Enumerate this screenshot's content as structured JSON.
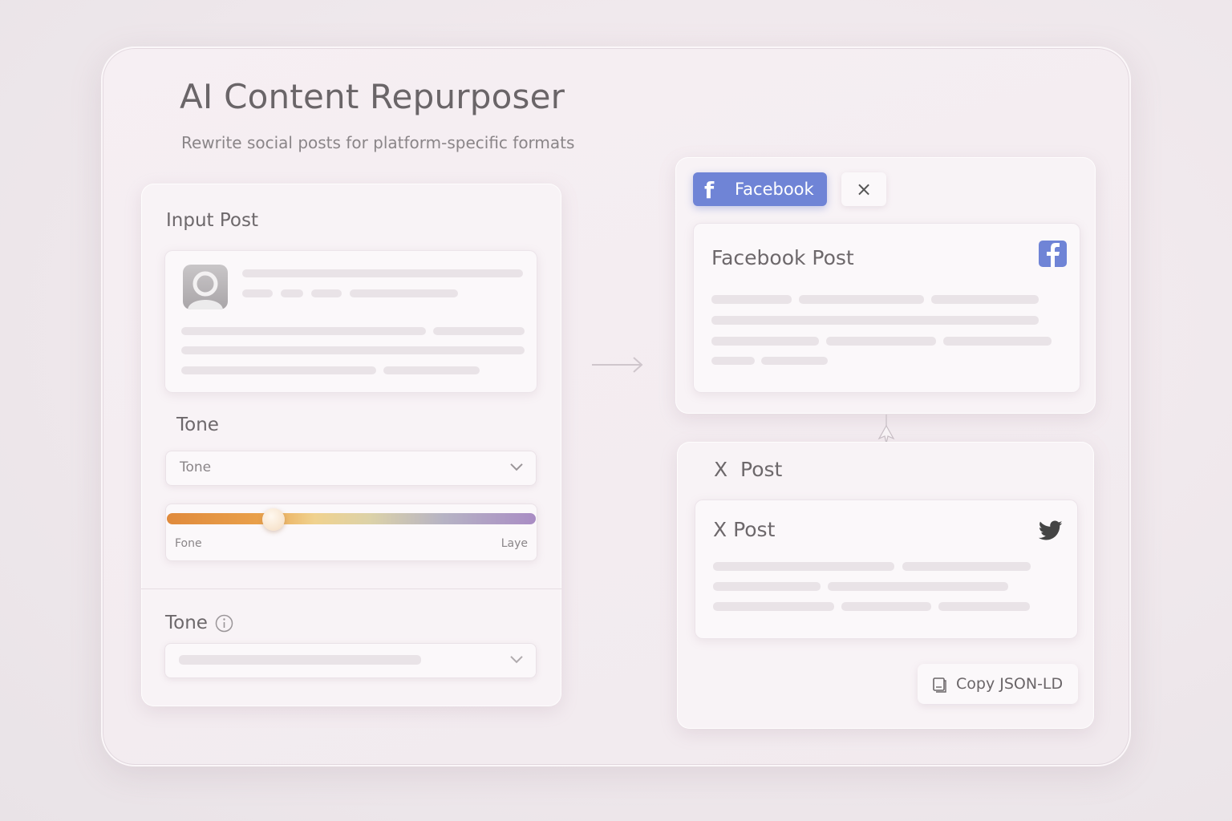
{
  "app": {
    "title": "AI Content Repurposer",
    "subtitle": "Rewrite social posts for platform-specific formats"
  },
  "input": {
    "heading": "Input Post",
    "tone_heading": "Tone",
    "tone_select_value": "Tone",
    "slider": {
      "min_label": "Fone",
      "max_label": "Laye",
      "level": 0.29
    },
    "tone_heading_2": "Tone"
  },
  "facebook": {
    "tab_label": "Facebook",
    "close_symbol": "×",
    "card_title": "Facebook Post",
    "icon": "facebook-icon"
  },
  "x": {
    "section_title": "X  Post",
    "card_title": "X Post",
    "icon": "twitter-bird-icon",
    "copy_label": "Copy JSON-LD"
  },
  "colors": {
    "facebook_blue": "#6f84d6",
    "background": "#f1eaee"
  }
}
